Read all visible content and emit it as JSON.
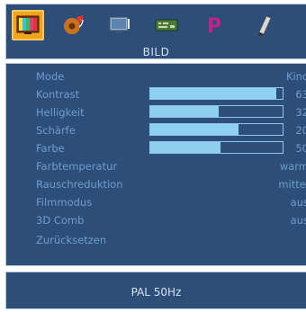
{
  "menu": {
    "title": "BILD",
    "icons": [
      {
        "name": "picture-menu-icon",
        "selected": true
      },
      {
        "name": "sound-menu-icon",
        "selected": false
      },
      {
        "name": "screen-menu-icon",
        "selected": false
      },
      {
        "name": "settings-menu-icon",
        "selected": false
      },
      {
        "name": "parental-menu-icon",
        "selected": false
      },
      {
        "name": "features-menu-icon",
        "selected": false
      }
    ]
  },
  "settings": {
    "items": [
      {
        "label": "Mode",
        "value": "Kino"
      },
      {
        "label": "Kontrast",
        "value": "63",
        "level": 0.95
      },
      {
        "label": "Helligkeit",
        "value": "32",
        "level": 0.52
      },
      {
        "label": "Schärfe",
        "value": "20",
        "level": 0.67
      },
      {
        "label": "Farbe",
        "value": "50",
        "level": 0.53
      },
      {
        "label": "Farbtemperatur",
        "value": "warm"
      },
      {
        "label": "Rauschreduktion",
        "value": "mittel"
      },
      {
        "label": "Filmmodus",
        "value": "aus"
      },
      {
        "label": "3D Comb",
        "value": "aus"
      },
      {
        "label": "Zurücksetzen",
        "value": ""
      }
    ]
  },
  "status": {
    "text": "PAL  50Hz"
  },
  "colors": {
    "panel": "#2c4e78",
    "label": "#6f9cd0",
    "bar_fill": "#8fd0f0",
    "selected_tab": "#f2a21c"
  }
}
